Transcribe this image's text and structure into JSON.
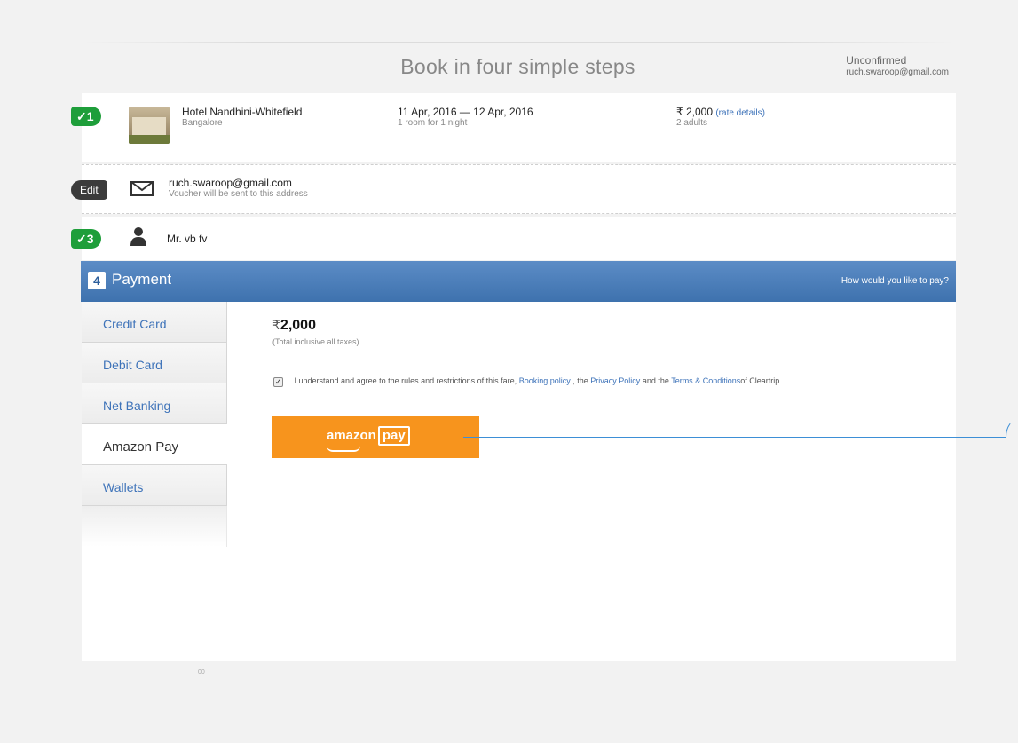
{
  "header": {
    "title": "Book in four simple steps",
    "status": "Unconfirmed",
    "email": "ruch.swaroop@gmail.com"
  },
  "step1": {
    "badge": "✓1",
    "hotel_name": "Hotel Nandhini-Whitefield",
    "city": "Bangalore",
    "dates": "11 Apr, 2016 — 12 Apr, 2016",
    "rooms": "1 room for 1 night",
    "price": "₹ 2,000",
    "rate_link": "(rate details)",
    "guests": "2 adults"
  },
  "step2": {
    "badge": "Edit",
    "email": "ruch.swaroop@gmail.com",
    "note": "Voucher will be sent to this address"
  },
  "step3": {
    "badge": "✓3",
    "name": "Mr. vb fv"
  },
  "payment": {
    "number": "4",
    "title": "Payment",
    "hint": "How would you like to pay?",
    "tabs": [
      {
        "label": "Credit Card"
      },
      {
        "label": "Debit Card"
      },
      {
        "label": "Net Banking"
      },
      {
        "label": "Amazon Pay"
      },
      {
        "label": "Wallets"
      }
    ],
    "active_tab": "Amazon Pay",
    "currency": "₹",
    "amount": "2,000",
    "amount_note": "(Total inclusive all taxes)",
    "agree_prefix": "I understand and agree to the rules and restrictions of this fare,",
    "booking_policy": "Booking policy",
    "comma": ", the",
    "privacy_policy": "Privacy Policy",
    "and": "and the",
    "terms": "Terms & Conditions",
    "suffix": "of Cleartrip",
    "amazon_text": "amazon",
    "amazon_pay": "pay"
  },
  "footer": {
    "dots": "00"
  },
  "colors": {
    "accent": "#3e73b9",
    "green": "#1e9e3a",
    "amazon": "#f7941d",
    "paybar": "#4a7dba"
  }
}
